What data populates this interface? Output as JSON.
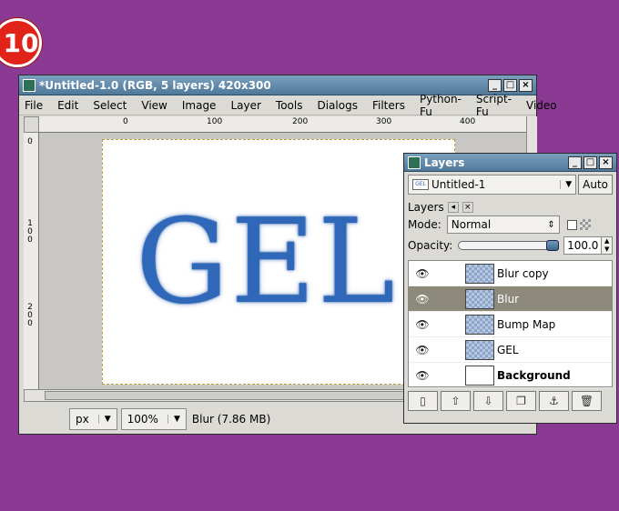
{
  "step_badge": "10",
  "image_window": {
    "title": "*Untitled-1.0 (RGB, 5 layers) 420x300",
    "menu": [
      "File",
      "Edit",
      "Select",
      "View",
      "Image",
      "Layer",
      "Tools",
      "Dialogs",
      "Filters",
      "Python-Fu",
      "Script-Fu",
      "Video"
    ],
    "ruler_top_labels": [
      "0",
      "100",
      "200",
      "300",
      "400"
    ],
    "ruler_left_labels": [
      "0",
      "100",
      "200"
    ],
    "canvas_text": "GEL",
    "status": {
      "unit": "px",
      "zoom": "100%",
      "text": "Blur (7.86 MB)"
    }
  },
  "layers_dock": {
    "title": "Layers",
    "image_selector": "Untitled-1",
    "image_thumb_text": "GEL",
    "auto_button": "Auto",
    "panel_title": "Layers",
    "mode_label": "Mode:",
    "mode_value": "Normal",
    "opacity_label": "Opacity:",
    "opacity_value": "100.0",
    "opacity_fraction": 1.0,
    "layers": [
      {
        "name": "Blur copy",
        "selected": false,
        "bold": false
      },
      {
        "name": "Blur",
        "selected": true,
        "bold": false
      },
      {
        "name": "Bump Map",
        "selected": false,
        "bold": false
      },
      {
        "name": "GEL",
        "selected": false,
        "bold": false
      },
      {
        "name": "Background",
        "selected": false,
        "bold": true
      }
    ],
    "buttons": [
      "new-layer-icon",
      "raise-layer-icon",
      "lower-layer-icon",
      "duplicate-layer-icon",
      "anchor-layer-icon",
      "delete-layer-icon"
    ]
  },
  "colors": {
    "background": "#8b3a93",
    "badge": "#e2231a",
    "titlebar": "#5f87a8",
    "text_gel": "#2f68b8",
    "selected_row": "#8d897b"
  }
}
